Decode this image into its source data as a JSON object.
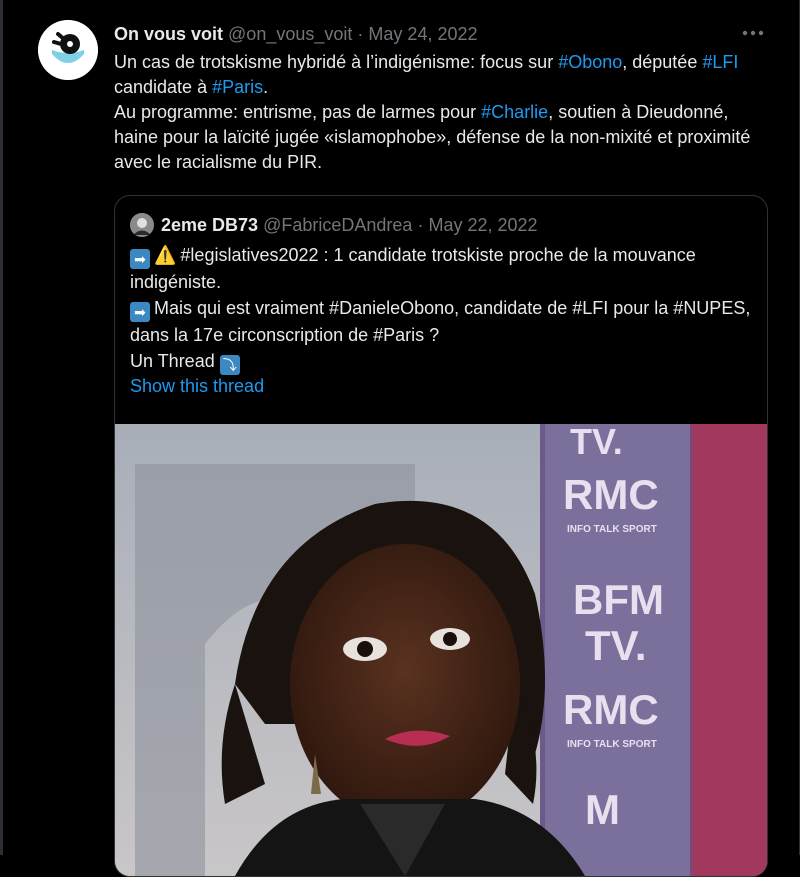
{
  "tweet": {
    "author_name": "On vous voit",
    "author_handle": "@on_vous_voit",
    "separator": "·",
    "date": "May 24, 2022",
    "more_icon": "ellipsis-icon",
    "text": {
      "l1_a": "Un cas de trotskisme hybridé à l’indigénisme: focus sur ",
      "l1_tag": "#Obono",
      "l1_b": ", députée",
      "l2_tag1": "#LFI",
      "l2_a": " candidate à ",
      "l2_tag2": "#Paris",
      "l2_b": ".",
      "l3_a": "Au programme: entrisme, pas de larmes pour ",
      "l3_tag": "#Charlie",
      "l3_b": ", soutien à Dieudonné, haine pour la laïcité jugée «islamophobe», défense de la non-mixité et proximité avec le racialisme du PIR."
    }
  },
  "quote": {
    "author_name": "2eme DB73",
    "author_handle": "@FabriceDAndrea",
    "separator": "·",
    "date": "May 22, 2022",
    "arrow_emoji": "➡",
    "warning_emoji": "⚠️",
    "line1": "#legislatives2022 : 1 candidate trotskiste proche de la mouvance indigéniste.",
    "line2": "Mais qui est vraiment #DanieleObono, candidate de #LFI pour la #NUPES, dans la 17e circonscription de #Paris ?",
    "line3": "Un Thread",
    "thread_emoji": "⤵",
    "show_thread": "Show this thread",
    "media": {
      "description_icon": "photo-image",
      "bg_text_1": "TV.",
      "bg_text_2": "RMC",
      "bg_text_3": "INFO TALK SPORT",
      "bg_text_4": "BFM",
      "bg_text_5": "TV.",
      "bg_text_6": "RMC",
      "bg_text_7": "INFO TALK SPORT",
      "bg_text_8": "M"
    }
  },
  "colors": {
    "background": "#000000",
    "text": "#e7e9ea",
    "muted": "#71767b",
    "link": "#1d9bf0",
    "border": "#2f3336"
  }
}
